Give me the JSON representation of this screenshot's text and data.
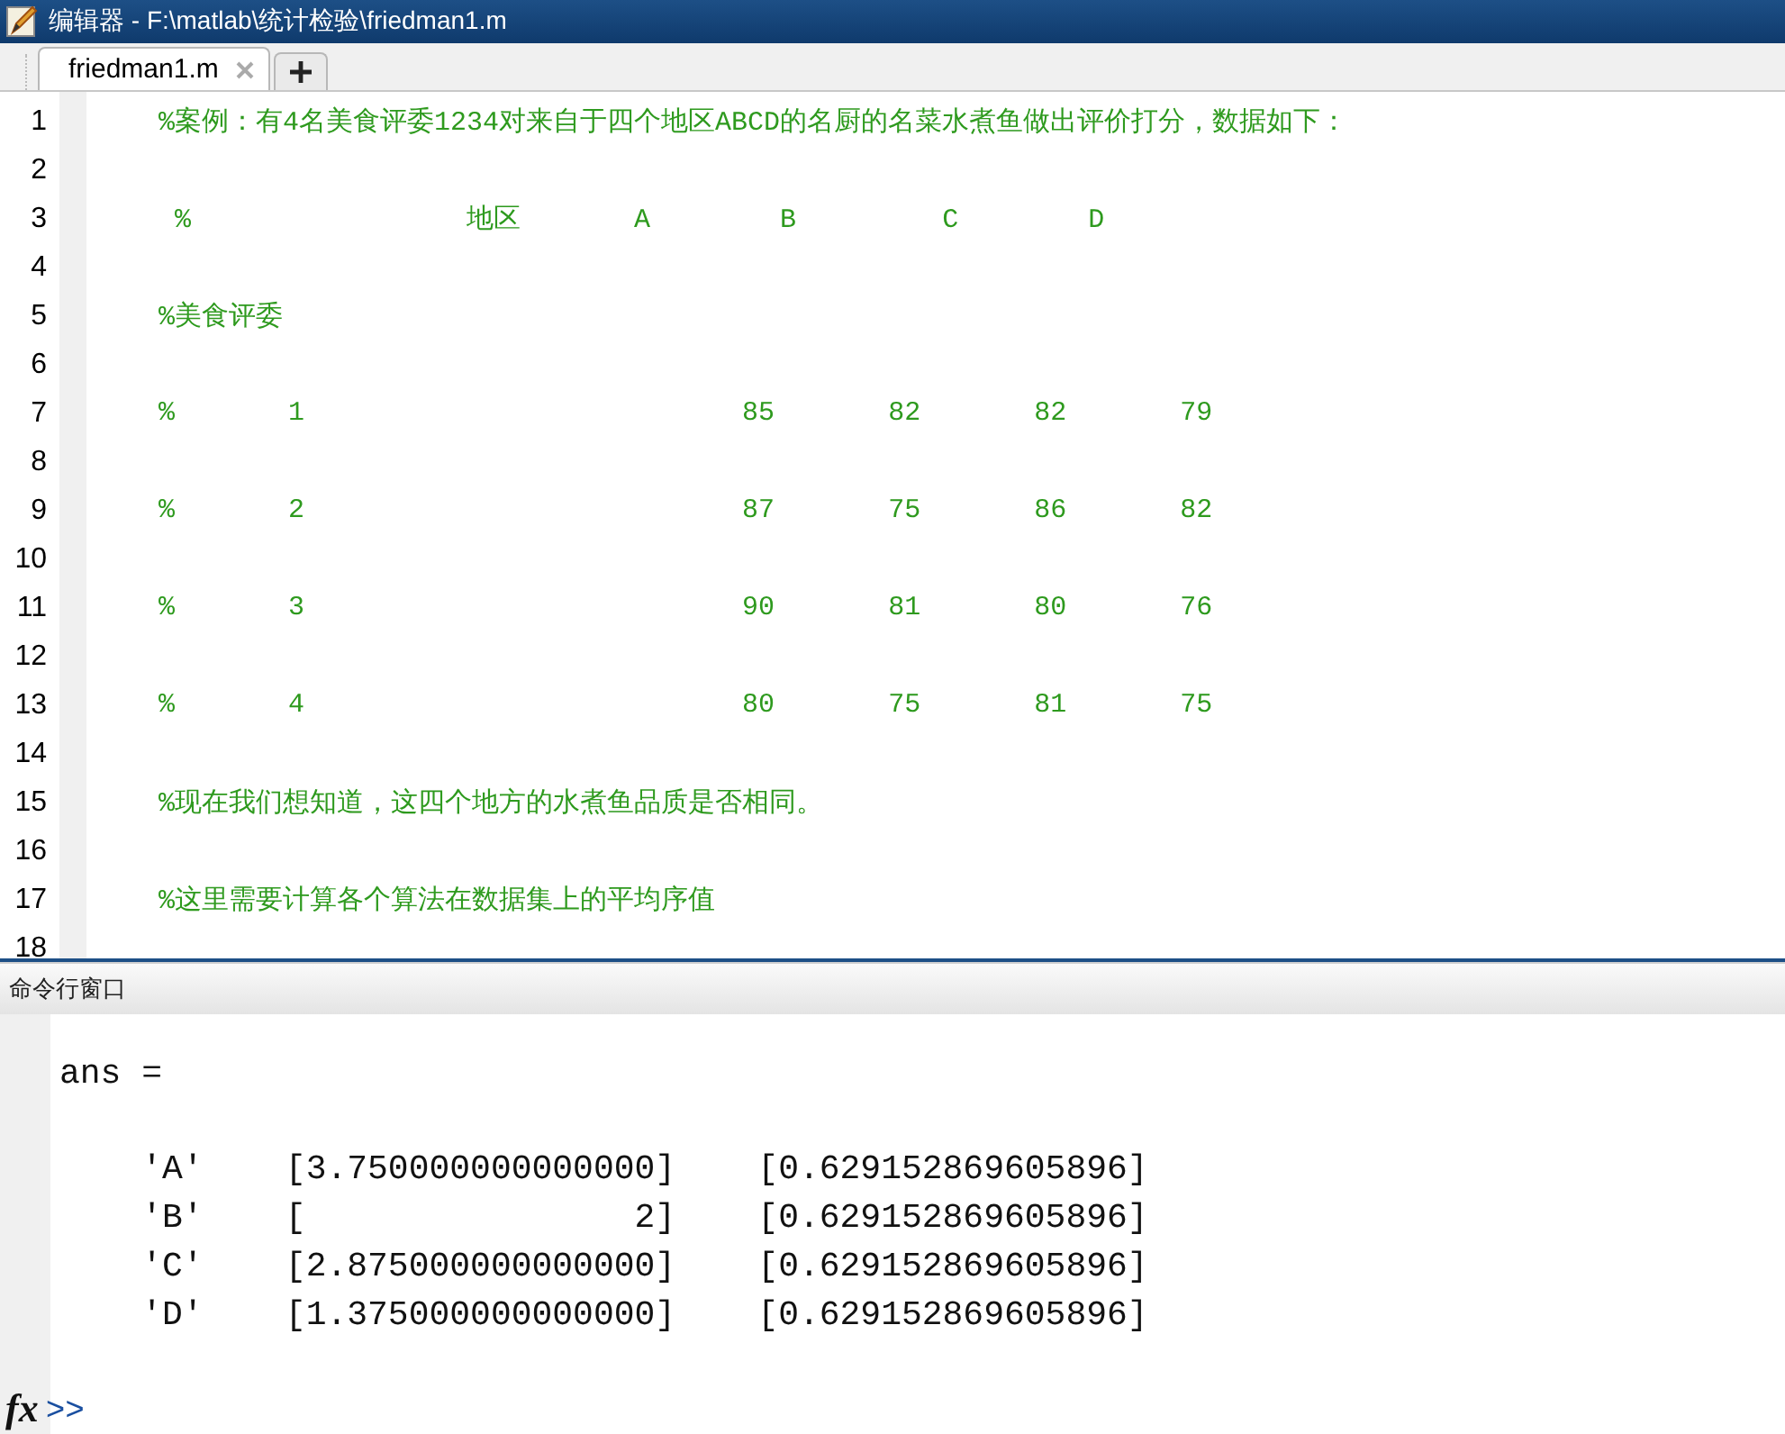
{
  "window": {
    "title": "编辑器 - F:\\matlab\\统计检验\\friedman1.m"
  },
  "tabs": [
    {
      "label": "friedman1.m",
      "selected": true
    }
  ],
  "editor": {
    "lines": [
      {
        "number": "1",
        "text": "%案例：有4名美食评委1234对来自于四个地区ABCD的名厨的名菜水煮鱼做出评价打分，数据如下："
      },
      {
        "number": "2"
      },
      {
        "number": "3",
        "text": " %                 地区       A        B         C        D"
      },
      {
        "number": "4"
      },
      {
        "number": "5",
        "text": "%美食评委"
      },
      {
        "number": "6"
      },
      {
        "number": "7",
        "text": "%       1                           85       82       82       79"
      },
      {
        "number": "8"
      },
      {
        "number": "9",
        "text": "%       2                           87       75       86       82"
      },
      {
        "number": "10"
      },
      {
        "number": "11",
        "text": "%       3                           90       81       80       76"
      },
      {
        "number": "12"
      },
      {
        "number": "13",
        "text": "%       4                           80       75       81       75"
      },
      {
        "number": "14"
      },
      {
        "number": "15",
        "text": "%现在我们想知道，这四个地方的水煮鱼品质是否相同。"
      },
      {
        "number": "16"
      },
      {
        "number": "17",
        "text": "%这里需要计算各个算法在数据集上的平均序值"
      },
      {
        "number": "18"
      }
    ]
  },
  "command_window": {
    "title": "命令行窗口",
    "header": "ans =",
    "rows": [
      "    'A'    [3.750000000000000]    [0.629152869605896]",
      "    'B'    [                2]    [0.629152869605896]",
      "    'C'    [2.875000000000000]    [0.629152869605896]",
      "    'D'    [1.375000000000000]    [0.629152869605896]"
    ],
    "function_button": "fx",
    "prompt": ">>"
  }
}
